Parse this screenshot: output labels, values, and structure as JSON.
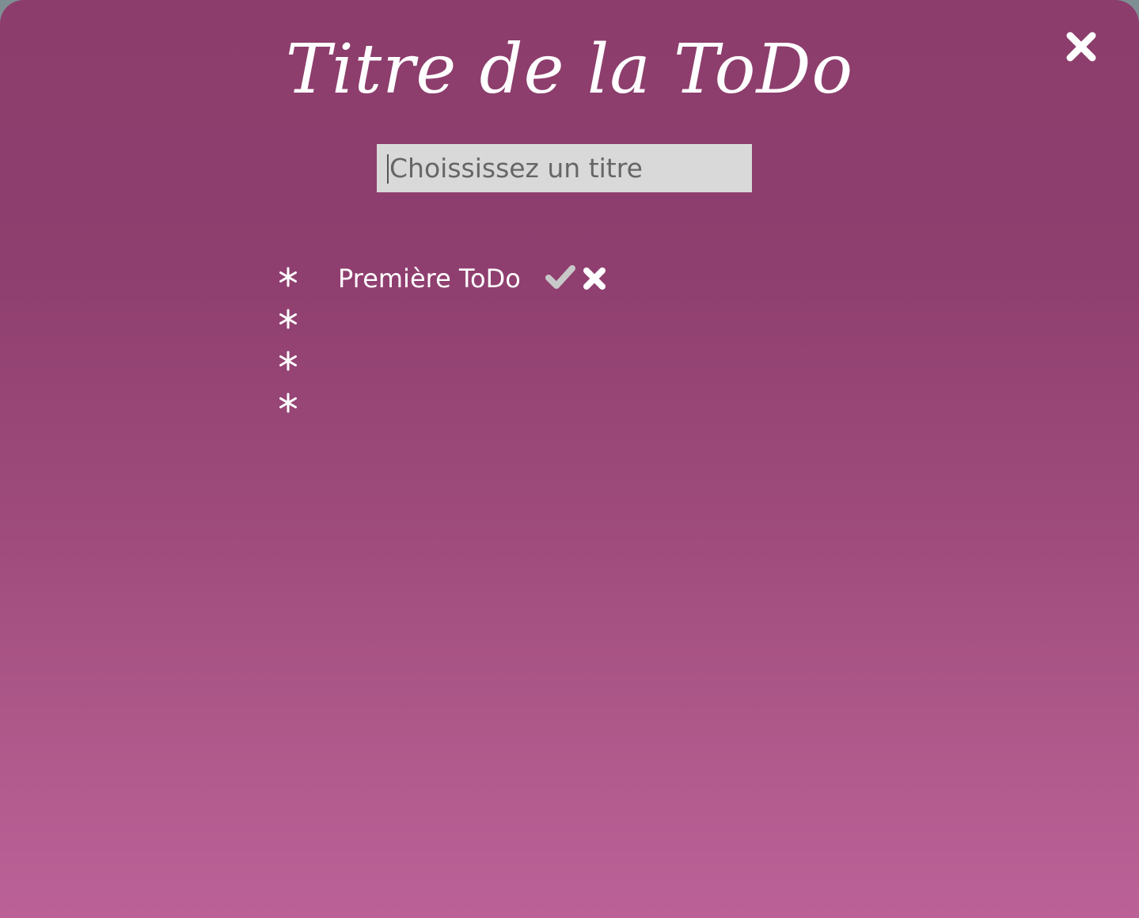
{
  "modal": {
    "title": "Titre de la ToDo",
    "close_icon": "close-icon"
  },
  "title_input": {
    "value": "",
    "placeholder": "Choississez un titre"
  },
  "todos": [
    {
      "text": "Première ToDo",
      "check_icon": "check-icon",
      "delete_icon": "delete-icon"
    },
    {
      "text": ""
    },
    {
      "text": ""
    },
    {
      "text": ""
    }
  ],
  "colors": {
    "panel_top": "#8c3d6c",
    "panel_bottom": "#bb6198",
    "input_bg": "#d9d9d9",
    "check_icon": "#c8c8c8",
    "text": "#ffffff"
  }
}
